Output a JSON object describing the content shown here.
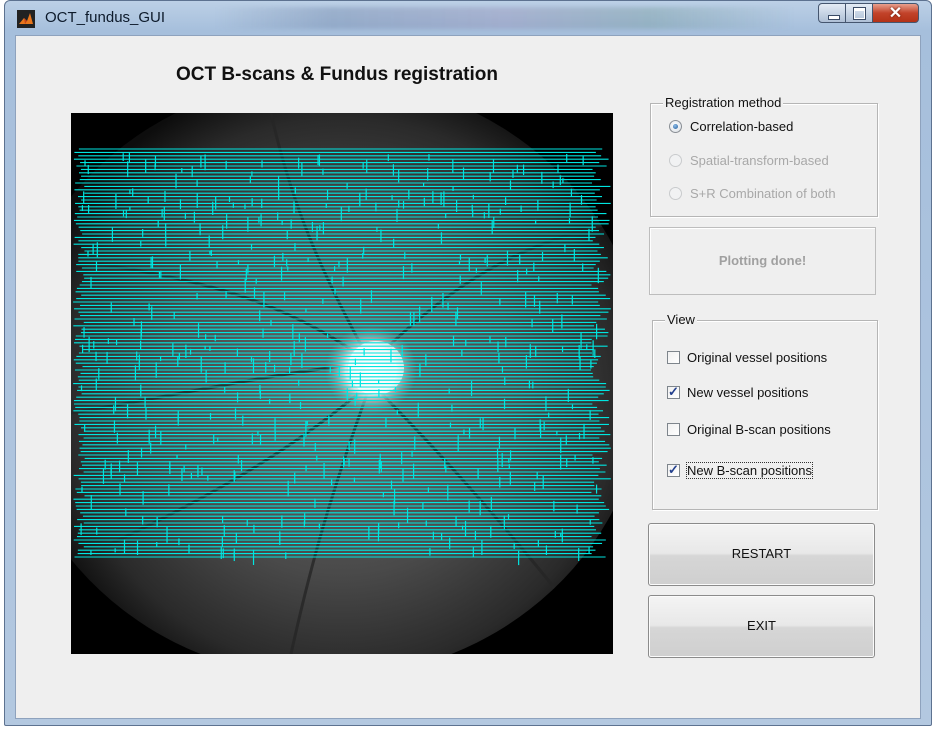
{
  "window": {
    "title": "OCT_fundus_GUI"
  },
  "heading": "OCT B-scans & Fundus registration",
  "registration": {
    "legend": "Registration method",
    "options": [
      {
        "label": "Correlation-based",
        "selected": true,
        "enabled": true
      },
      {
        "label": "Spatial-transform-based",
        "selected": false,
        "enabled": false
      },
      {
        "label": "S+R Combination of both",
        "selected": false,
        "enabled": false
      }
    ]
  },
  "status": "Plotting done!",
  "view": {
    "legend": "View",
    "options": [
      {
        "label": "Original vessel positions",
        "checked": false
      },
      {
        "label": "New vessel positions",
        "checked": true
      },
      {
        "label": "Original B-scan positions",
        "checked": false
      },
      {
        "label": "New B-scan positions",
        "checked": true
      }
    ]
  },
  "buttons": {
    "restart": "RESTART",
    "exit": "EXIT"
  },
  "colors": {
    "overlay": "#00e5e0",
    "window_frame": "#b3c8e0",
    "client_bg": "#efefef"
  },
  "icons": {
    "app": "matlab-icon",
    "minimize": "minimize-icon",
    "maximize": "maximize-icon",
    "close": "close-icon"
  }
}
